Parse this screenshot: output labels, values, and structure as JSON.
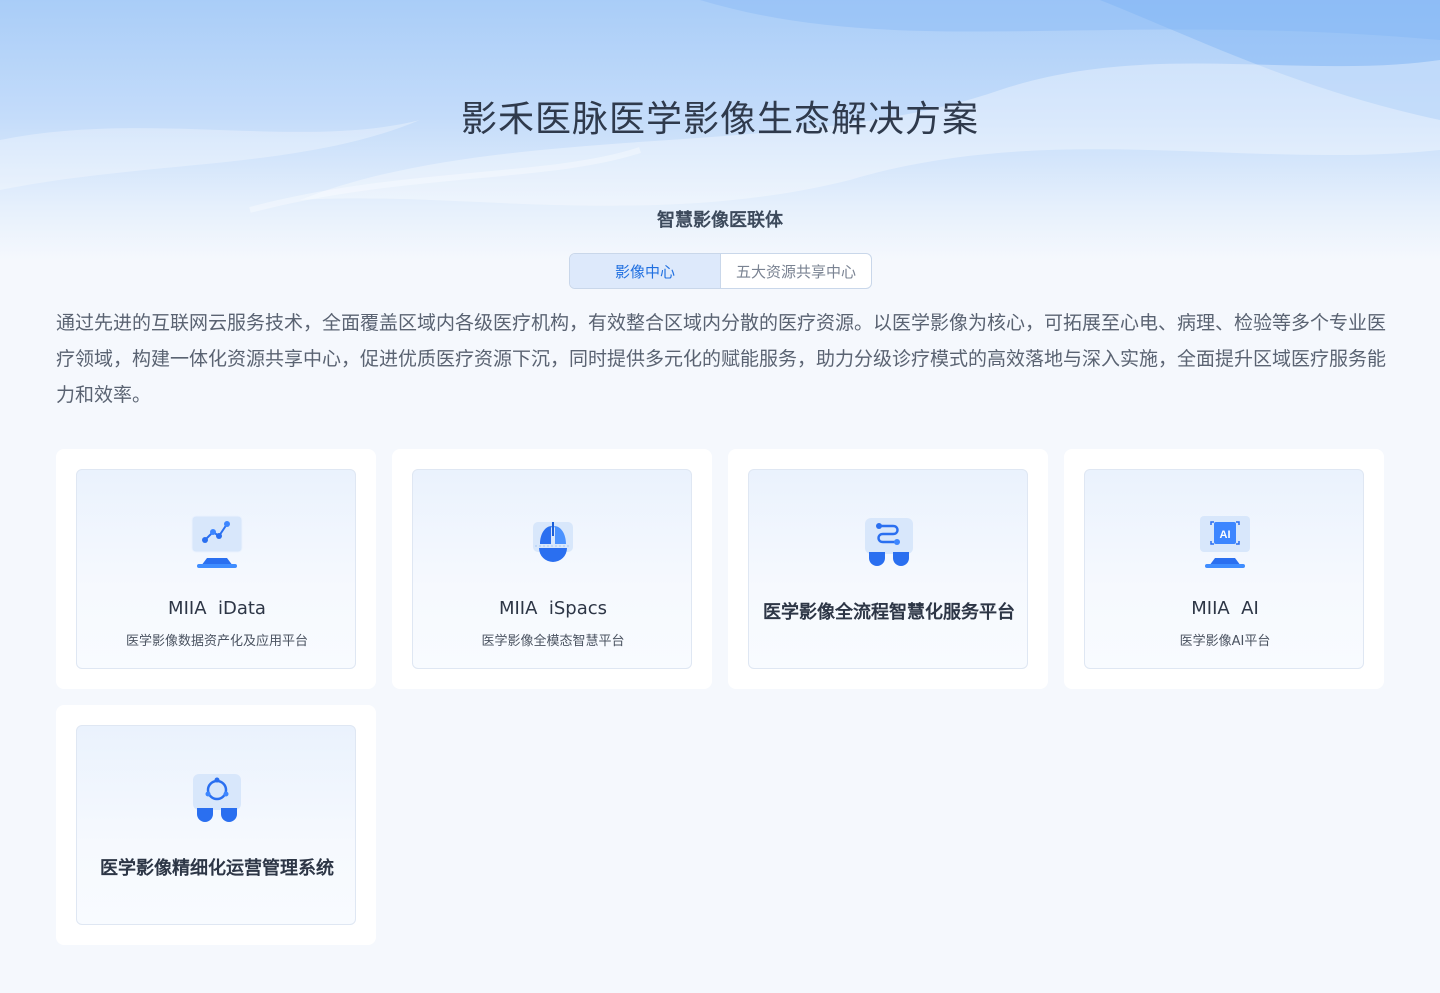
{
  "page": {
    "title": "影禾医脉医学影像生态解决方案"
  },
  "section": {
    "title": "智慧影像医联体",
    "tabs": [
      {
        "label": "影像中心",
        "active": true
      },
      {
        "label": "五大资源共享中心",
        "active": false
      }
    ],
    "intro": "通过先进的互联网云服务技术，全面覆盖区域内各级医疗机构，有效整合区域内分散的医疗资源。以医学影像为核心，可拓展至心电、病理、检验等多个专业医疗领域，构建一体化资源共享中心，促进优质医疗资源下沉，同时提供多元化的赋能服务，助力分级诊疗模式的高效落地与深入实施，全面提升区域医疗服务能力和效率。"
  },
  "cards": [
    {
      "title": "MIIA  iData",
      "subtitle": "医学影像数据资产化及应用平台",
      "icon": "data-chart-icon"
    },
    {
      "title": "MIIA  iSpacs",
      "subtitle": "医学影像全模态智慧平台",
      "icon": "lungs-icon"
    },
    {
      "title": "医学影像全流程智慧化服务平台",
      "subtitle": "",
      "icon": "workflow-icon"
    },
    {
      "title": "MIIA  AI",
      "subtitle": "医学影像AI平台",
      "icon": "ai-chip-icon"
    },
    {
      "title": "医学影像精细化运营管理系统",
      "subtitle": "",
      "icon": "operations-cycle-icon"
    }
  ],
  "colors": {
    "accent": "#1f6fe0",
    "icon_blue": "#2a6ff0",
    "background": "#f5f8fd"
  }
}
